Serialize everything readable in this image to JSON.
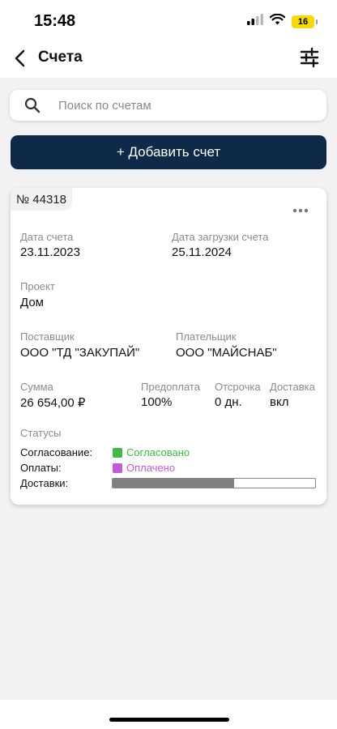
{
  "status_bar": {
    "time": "15:48",
    "battery": "16",
    "icons": [
      "signal-icon",
      "wifi-icon",
      "battery-icon"
    ]
  },
  "nav": {
    "title": "Счета",
    "back_icon": "chevron-left-icon",
    "filter_icon": "sliders-icon"
  },
  "search": {
    "placeholder": "Поиск по счетам",
    "value": ""
  },
  "add_button_label": "+ Добавить счет",
  "invoice": {
    "number": "№ 44318",
    "date_label": "Дата счета",
    "date_value": "23.11.2023",
    "upload_date_label": "Дата загрузки счета",
    "upload_date_value": "25.11.2024",
    "project_label": "Проект",
    "project_value": "Дом",
    "supplier_label": "Поставщик",
    "supplier_value": "ООО \"ТД \"ЗАКУПАЙ\"",
    "payer_label": "Плательщик",
    "payer_value": "ООО \"МАЙСНАБ\"",
    "sum_label": "Сумма",
    "sum_value": "26 654,00 ₽",
    "prepay_label": "Предоплата",
    "prepay_value": "100%",
    "deferral_label": "Отсрочка",
    "deferral_value": "0 дн.",
    "delivery_label": "Доставка",
    "delivery_value": "вкл",
    "statuses_label": "Статусы",
    "approval_label": "Согласование:",
    "approval_value": "Согласовано",
    "approval_color": "#3fb94a",
    "payment_label": "Оплаты:",
    "payment_value": "Оплачено",
    "payment_color": "#c25bd6",
    "deliveries_label": "Доставки:",
    "deliveries_progress": 0.6
  }
}
